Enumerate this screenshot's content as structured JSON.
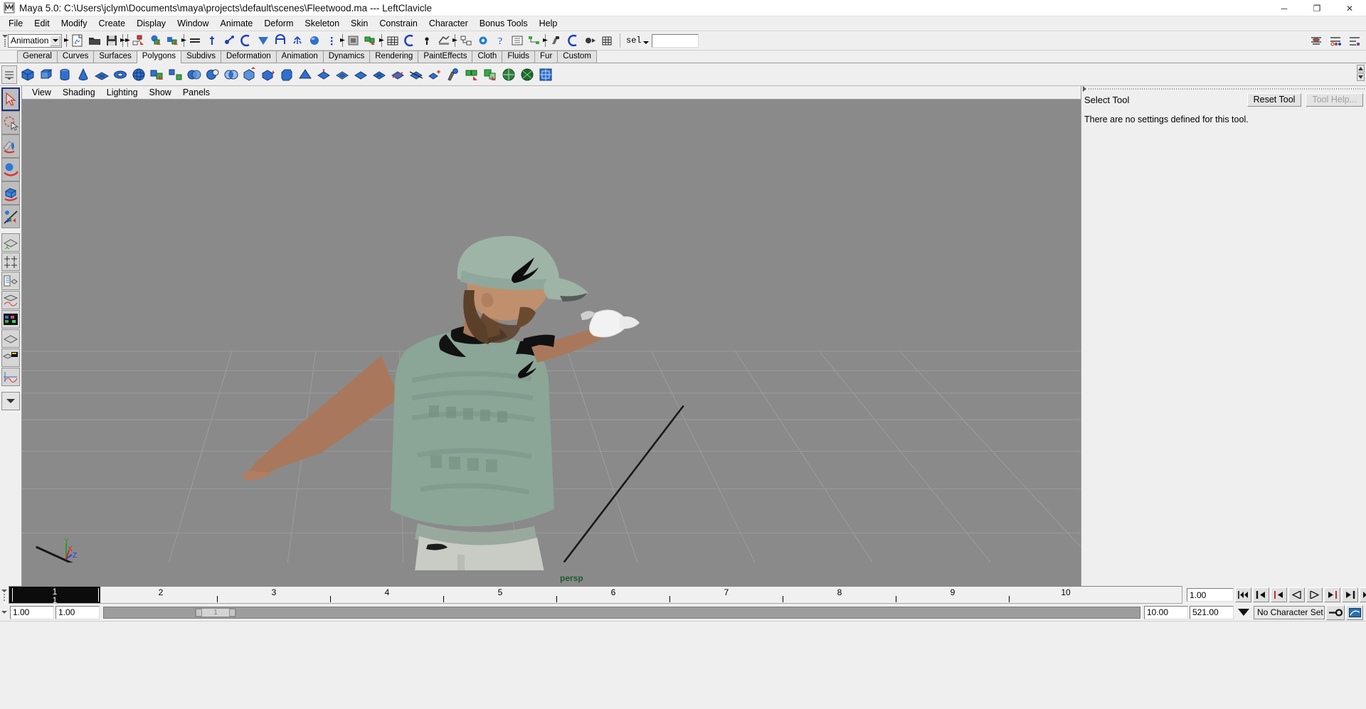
{
  "window": {
    "title": "Maya 5.0: C:\\Users\\jclym\\Documents\\maya\\projects\\default\\scenes\\Fleetwood.ma  ---  LeftClavicle",
    "app_icon": "maya-icon",
    "minimize": "─",
    "maximize": "❐",
    "close": "✕"
  },
  "menubar": {
    "items": [
      {
        "label": "File"
      },
      {
        "label": "Edit"
      },
      {
        "label": "Modify"
      },
      {
        "label": "Create"
      },
      {
        "label": "Display"
      },
      {
        "label": "Window"
      },
      {
        "label": "Animate"
      },
      {
        "label": "Deform"
      },
      {
        "label": "Skeleton"
      },
      {
        "label": "Skin"
      },
      {
        "label": "Constrain"
      },
      {
        "label": "Character"
      },
      {
        "label": "Bonus Tools"
      },
      {
        "label": "Help"
      }
    ]
  },
  "statusline": {
    "menuset": "Animation",
    "selection_mask_label": "sel",
    "name_field_value": "",
    "name_field_placeholder": ""
  },
  "shelf": {
    "tabs": [
      {
        "label": "General",
        "active": false
      },
      {
        "label": "Curves",
        "active": false
      },
      {
        "label": "Surfaces",
        "active": false
      },
      {
        "label": "Polygons",
        "active": true
      },
      {
        "label": "Subdivs",
        "active": false
      },
      {
        "label": "Deformation",
        "active": false
      },
      {
        "label": "Animation",
        "active": false
      },
      {
        "label": "Dynamics",
        "active": false
      },
      {
        "label": "Rendering",
        "active": false
      },
      {
        "label": "PaintEffects",
        "active": false
      },
      {
        "label": "Cloth",
        "active": false
      },
      {
        "label": "Fluids",
        "active": false
      },
      {
        "label": "Fur",
        "active": false
      },
      {
        "label": "Custom",
        "active": false
      }
    ]
  },
  "toolbox": {
    "tools": [
      {
        "name": "select-tool",
        "active": true
      },
      {
        "name": "lasso-select-tool",
        "active": false
      },
      {
        "name": "paint-select-tool",
        "active": false
      },
      {
        "name": "move-tool",
        "active": false
      },
      {
        "name": "rotate-tool",
        "active": false
      },
      {
        "name": "scale-tool",
        "active": false
      },
      {
        "name": "show-manipulator-tool",
        "active": false
      }
    ]
  },
  "viewport": {
    "menus": [
      {
        "label": "View"
      },
      {
        "label": "Shading"
      },
      {
        "label": "Lighting"
      },
      {
        "label": "Show"
      },
      {
        "label": "Panels"
      }
    ],
    "camera_label": "persp",
    "camera_label_color": "#1d5c2a",
    "background_color": "#8a8a8a",
    "grid_color": "#9c9c9c",
    "axis_gizmo": {
      "x": "X",
      "y": "Y",
      "z": "Z",
      "x_color": "#e02020",
      "y_color": "#21a021",
      "z_color": "#2040e0"
    }
  },
  "tool_settings_panel": {
    "title": "Select Tool",
    "reset_label": "Reset Tool",
    "help_label": "Tool Help...",
    "help_disabled": true,
    "body_text": "There are no settings defined for this tool."
  },
  "timeline": {
    "current_frame": "1",
    "current_frame_sub": "1",
    "ticks": [
      "1",
      "2",
      "3",
      "4",
      "5",
      "6",
      "7",
      "8",
      "9",
      "10"
    ],
    "current_frame_field": "1.00",
    "playback_buttons": [
      {
        "name": "go-to-start-button",
        "glyph": "⏮◂"
      },
      {
        "name": "step-back-keyframe-button",
        "glyph": "▮◂"
      },
      {
        "name": "step-back-frame-button",
        "glyph": "❘◂"
      },
      {
        "name": "play-backwards-button",
        "glyph": "◂"
      },
      {
        "name": "play-forwards-button",
        "glyph": "▸"
      },
      {
        "name": "step-forward-frame-button",
        "glyph": "▸❘"
      },
      {
        "name": "step-forward-keyframe-button",
        "glyph": "▸▮"
      },
      {
        "name": "go-to-end-button",
        "glyph": "▸⏭"
      }
    ]
  },
  "range_row": {
    "range_start": "1.00",
    "range_end": "1.00",
    "playback_start": "10.00",
    "playback_end": "521.00",
    "character_set": "No Character Set",
    "auto_key_icon": "key-icon",
    "anim_prefs_icon": "animation-preferences-icon"
  }
}
